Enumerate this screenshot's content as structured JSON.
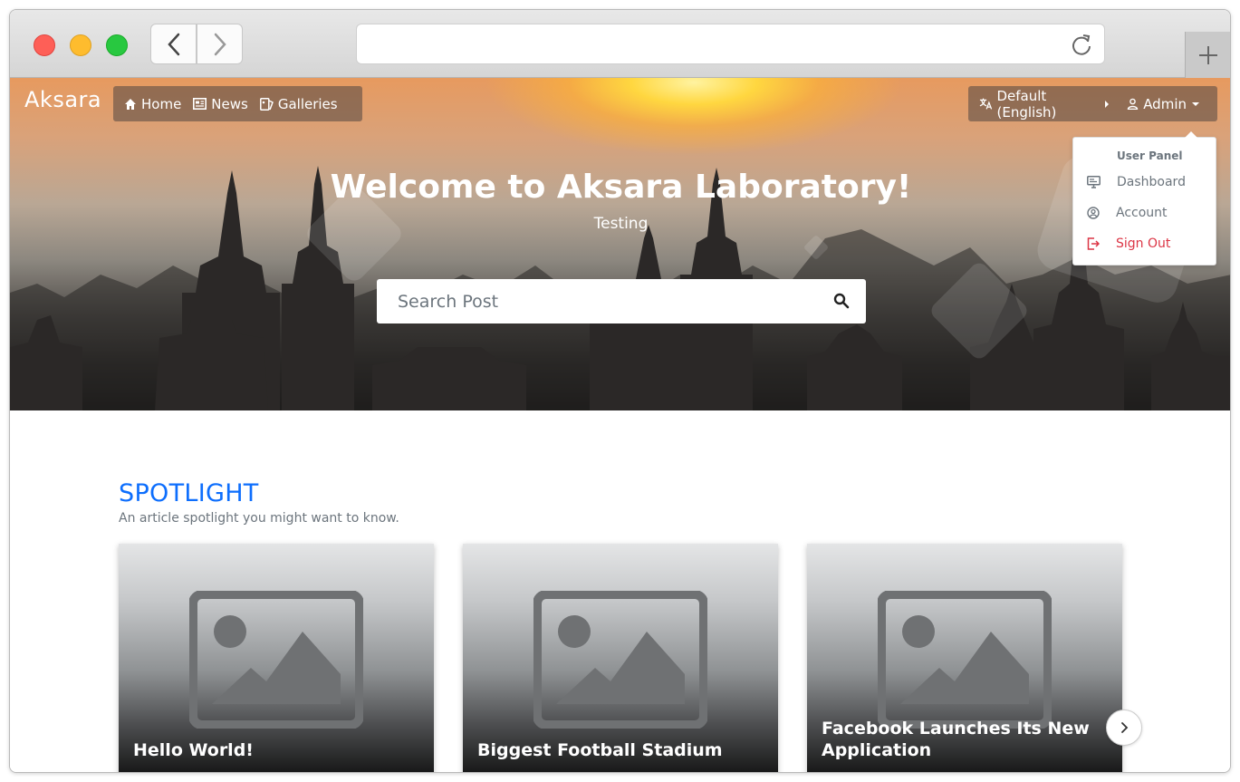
{
  "navbar": {
    "brand": "Aksara",
    "items": [
      {
        "label": "Home",
        "icon": "home-icon"
      },
      {
        "label": "News",
        "icon": "newspaper-icon"
      },
      {
        "label": "Galleries",
        "icon": "gallery-icon"
      }
    ],
    "language": {
      "label": "Default (English)",
      "icon": "language-icon"
    },
    "user": {
      "label": "Admin",
      "icon": "user-icon"
    }
  },
  "user_menu": {
    "header": "User Panel",
    "items": [
      {
        "label": "Dashboard",
        "icon": "monitor-icon"
      },
      {
        "label": "Account",
        "icon": "user-circle-icon"
      },
      {
        "label": "Sign Out",
        "icon": "sign-out-icon",
        "color": "#dc3545"
      }
    ]
  },
  "hero": {
    "title": "Welcome to Aksara Laboratory!",
    "subtitle": "Testing",
    "search_placeholder": "Search Post"
  },
  "spotlight": {
    "title": "SPOTLIGHT",
    "subtitle": "An article spotlight you might want to know.",
    "cards": [
      {
        "title": "Hello World!"
      },
      {
        "title": "Biggest Football Stadium"
      },
      {
        "title": "Facebook Launches Its New Application"
      }
    ]
  },
  "colors": {
    "accent": "#0d6efd",
    "danger": "#dc3545"
  }
}
